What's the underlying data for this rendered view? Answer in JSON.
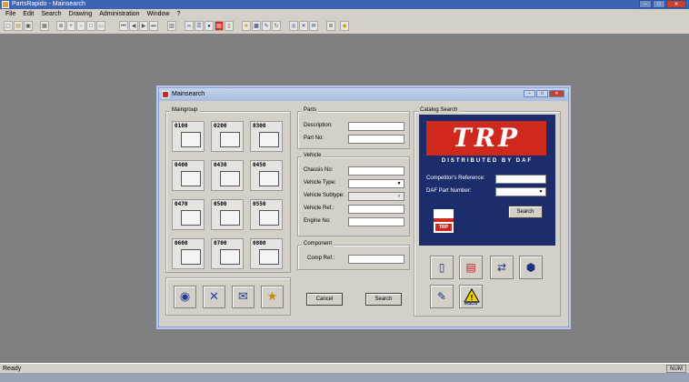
{
  "app": {
    "title": "PartsRapido - Mainsearch",
    "window_buttons": [
      "–",
      "□",
      "✕"
    ]
  },
  "menu": [
    "File",
    "Edit",
    "Search",
    "Drawing",
    "Administration",
    "Window",
    "?"
  ],
  "toolbar": {
    "icons": [
      "new-icon",
      "open-icon",
      "save-icon",
      "print-icon",
      "zoom-icon",
      "zoom-in-icon",
      "zoom-out-icon",
      "fit-icon",
      "page-icon",
      "first-icon",
      "prev-icon",
      "next-icon",
      "last-icon",
      "grid-icon",
      "binoculars-icon",
      "filter-icon",
      "circle-icon",
      "flag-icon",
      "doc-icon",
      "star-icon",
      "catalog-icon",
      "wrench-icon",
      "refresh-icon",
      "target-icon",
      "expand-icon",
      "mail-icon",
      "list-icon",
      "shield-icon"
    ]
  },
  "dialog": {
    "title": "Mainsearch",
    "buttons": [
      "–",
      "□",
      "✕"
    ],
    "maingroup": {
      "legend": "Maingroup",
      "codes": [
        "0100",
        "0200",
        "0300",
        "0400",
        "0430",
        "0450",
        "0470",
        "0500",
        "0550",
        "0600",
        "0700",
        "0800"
      ]
    },
    "parts": {
      "legend": "Parts",
      "description_label": "Description:",
      "description_value": "",
      "partno_label": "Part No:",
      "partno_value": ""
    },
    "vehicle": {
      "legend": "Vehicle",
      "chassis_label": "Chassis No:",
      "type_label": "Vehicle Type:",
      "subtype_label": "Vehicle Subtype:",
      "ref_label": "Vehicle Ref.:",
      "engine_label": "Engine No:"
    },
    "component": {
      "legend": "Component",
      "compref_label": "Comp Ref.:"
    },
    "cancel_label": "Cancel",
    "search_label": "Search",
    "catalog": {
      "legend": "Catalog Search",
      "logo": "TRP",
      "tagline": "DISTRIBUTED BY DAF",
      "competitor_label": "Competitor's Reference:",
      "daf_label": "DAF Part Number:",
      "search_label": "Search",
      "small_logo": "TRP"
    },
    "tools": {
      "msds_label": "MSDS"
    }
  },
  "status": {
    "text": "Ready",
    "num": "NUM"
  },
  "colors": {
    "titlebar": "#3c64b4",
    "catalog_bg": "#1c2d6c",
    "trp_red": "#d0281c"
  }
}
